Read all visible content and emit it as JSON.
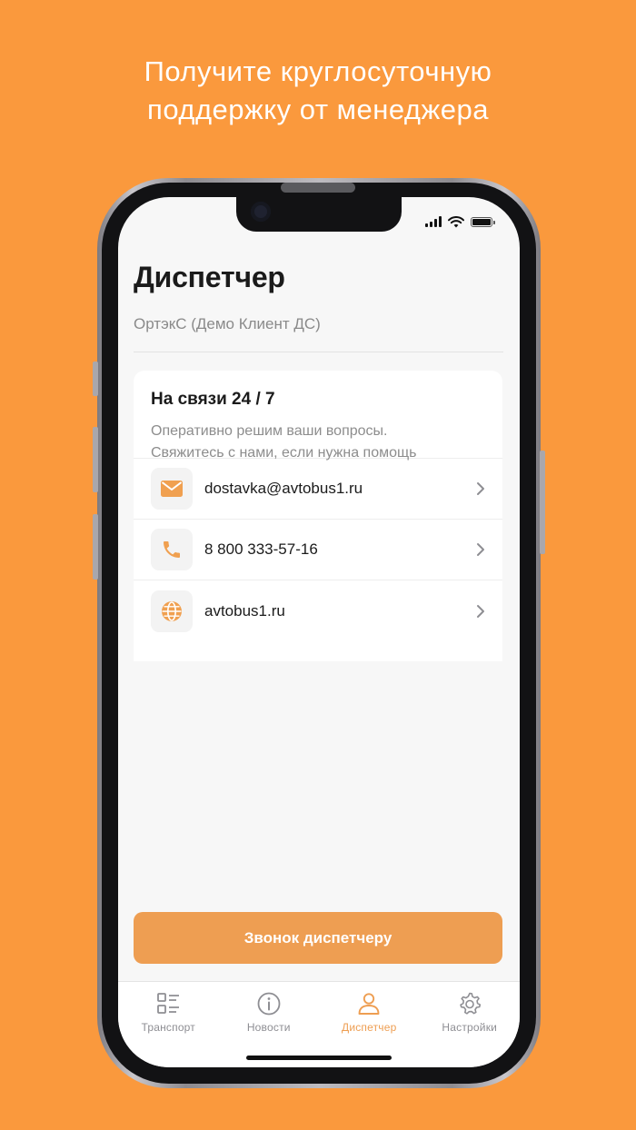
{
  "promo": {
    "line1": "Получите круглосуточную",
    "line2": "поддержку от менеджера"
  },
  "screen": {
    "title": "Диспетчер",
    "subtitle": "ОртэкС (Демо Клиент ДС)"
  },
  "card": {
    "title": "На связи 24 / 7",
    "desc_line1": "Оперативно решим ваши вопросы.",
    "desc_line2": "Свяжитесь с нами, если нужна помощь",
    "rows": [
      {
        "icon": "mail-icon",
        "text": "dostavka@avtobus1.ru"
      },
      {
        "icon": "phone-icon",
        "text": "8 800 333-57-16"
      },
      {
        "icon": "globe-icon",
        "text": "avtobus1.ru"
      }
    ]
  },
  "call_button": "Звонок диспетчеру",
  "tabs": [
    {
      "icon": "list-icon",
      "label": "Транспорт",
      "active": false
    },
    {
      "icon": "info-icon",
      "label": "Новости",
      "active": false
    },
    {
      "icon": "person-icon",
      "label": "Диспетчер",
      "active": true
    },
    {
      "icon": "gear-icon",
      "label": "Настройки",
      "active": false
    }
  ],
  "colors": {
    "background": "#FA993D",
    "accent": "#EE9E52",
    "icon_accent": "#F0A050"
  }
}
